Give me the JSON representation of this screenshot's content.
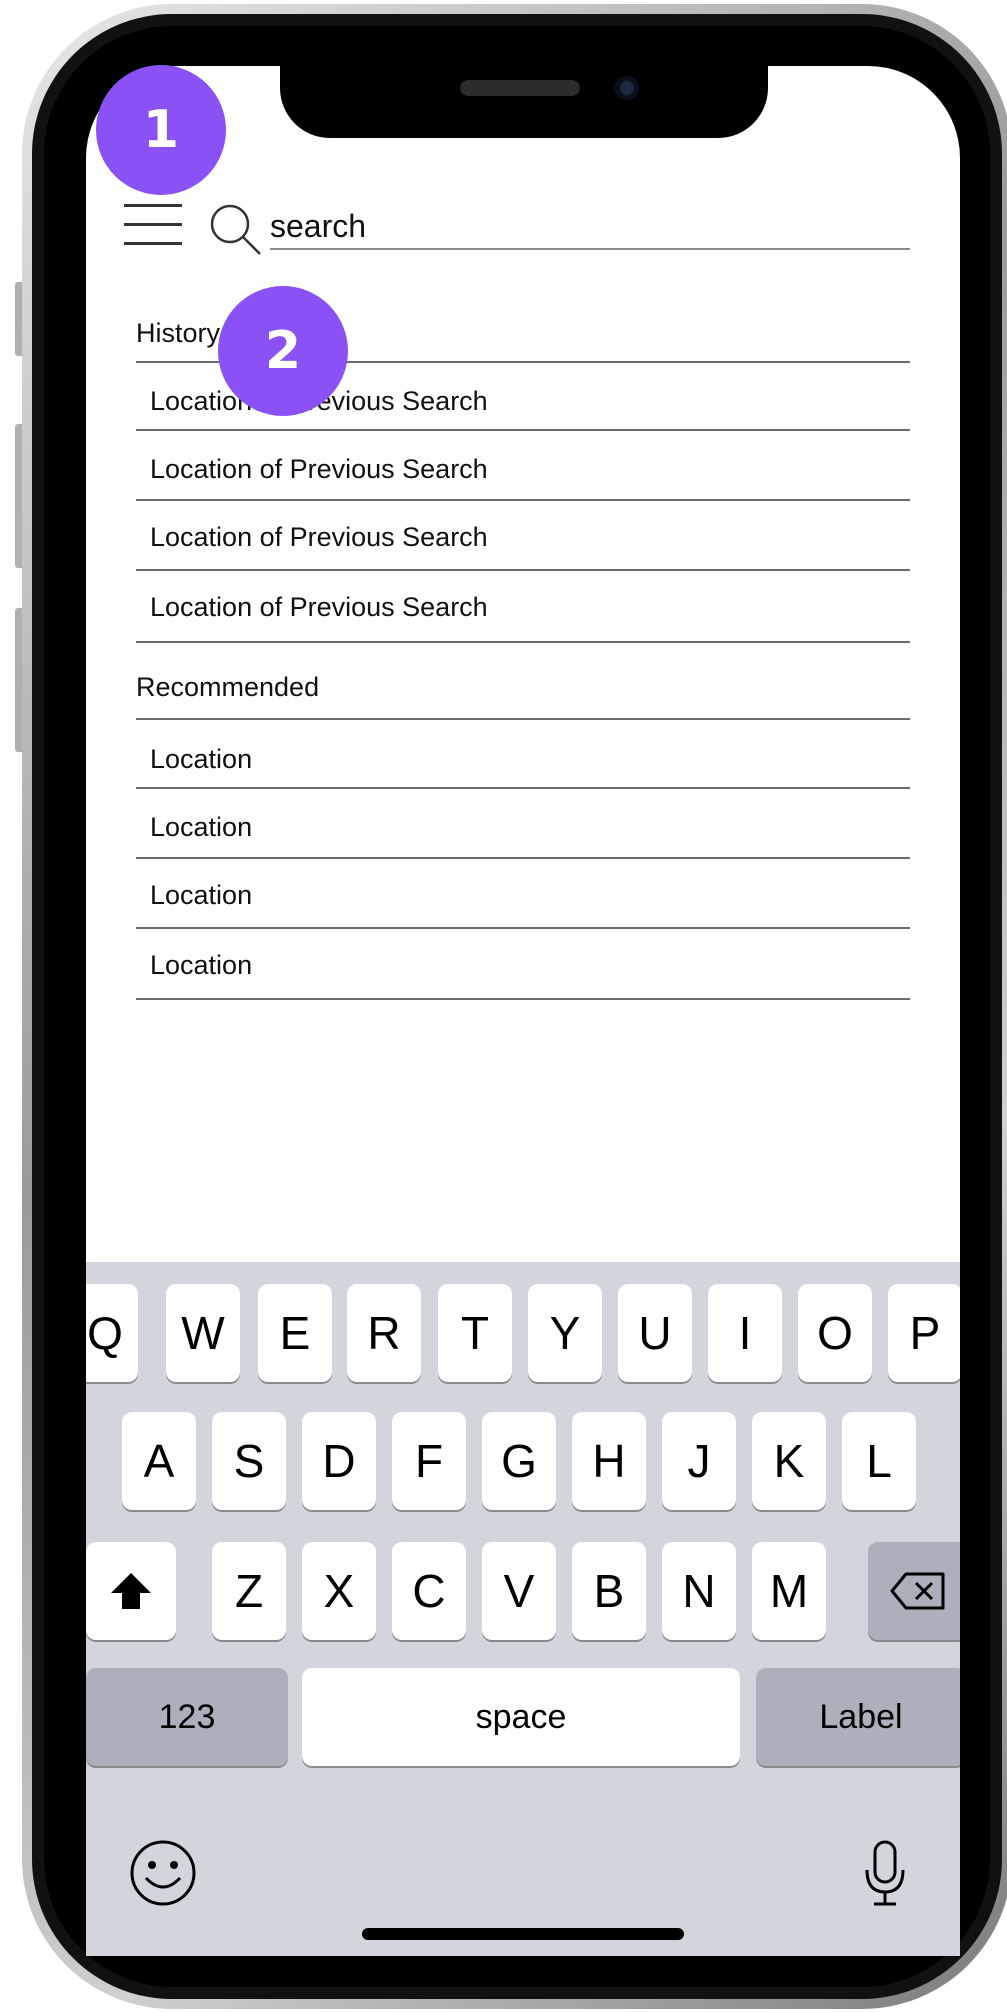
{
  "annotations": {
    "badge_1": "1",
    "badge_2": "2"
  },
  "search": {
    "value": "search"
  },
  "history": {
    "header": "History",
    "items": [
      "Location of Previous Search",
      "Location of Previous Search",
      "Location of Previous Search",
      "Location of Previous Search"
    ]
  },
  "recommended": {
    "header": "Recommended",
    "items": [
      "Location",
      "Location",
      "Location",
      "Location"
    ]
  },
  "keyboard": {
    "row1": [
      "Q",
      "W",
      "E",
      "R",
      "T",
      "Y",
      "U",
      "I",
      "O",
      "P"
    ],
    "row2": [
      "A",
      "S",
      "D",
      "F",
      "G",
      "H",
      "J",
      "K",
      "L"
    ],
    "row3": [
      "Z",
      "X",
      "C",
      "V",
      "B",
      "N",
      "M"
    ],
    "numbers_key": "123",
    "space_key": "space",
    "action_key": "Label"
  },
  "colors": {
    "badge": "#8a52f5",
    "keyboard_bg": "#d2d5db"
  }
}
